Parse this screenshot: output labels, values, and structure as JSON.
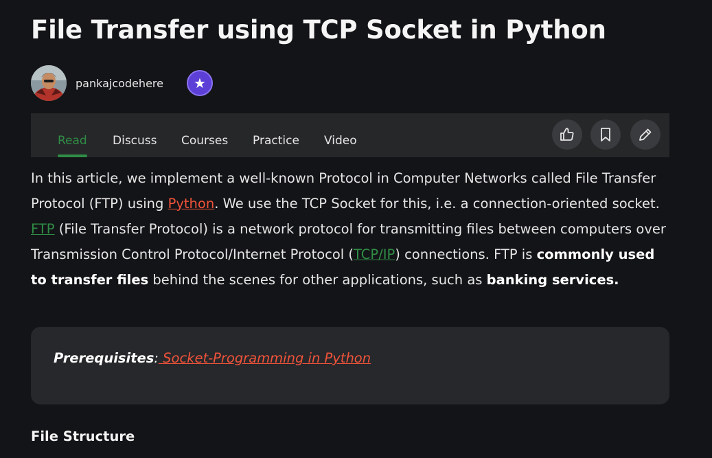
{
  "article": {
    "title": "File Transfer using TCP Socket in Python",
    "author": "pankajcodehere",
    "body": {
      "p1_a": "In this article, we implement a well-known Protocol in Computer Networks called File Transfer Protocol (FTP) using ",
      "link_python": "Python",
      "p1_b": ". We use the TCP Socket for this, i.e. a connection-oriented socket. ",
      "link_ftp": "FTP",
      "p1_c": " (File Transfer Protocol) is a network protocol for transmitting files between computers over Transmission Control Protocol/Internet Protocol (",
      "link_tcpip": "TCP/IP",
      "p1_d": ") connections. FTP is ",
      "bold_1": "commonly used to transfer files",
      "p1_e": " behind the scenes for other applications, such as ",
      "bold_2": "banking services."
    },
    "prerequisites": {
      "label": "Prerequisites",
      "colon": ":",
      "link": " Socket-Programming in Python"
    },
    "section_heading": "File Structure"
  },
  "tabs": {
    "read": "Read",
    "discuss": "Discuss",
    "courses": "Courses",
    "practice": "Practice",
    "video": "Video"
  },
  "icons": {
    "badge": "star-badge-icon",
    "like": "thumbs-up-icon",
    "bookmark": "bookmark-icon",
    "edit": "pencil-icon"
  },
  "colors": {
    "background": "#131417",
    "panel": "#262729",
    "accent_green": "#2f8d46",
    "link_red": "#f0533a",
    "badge_purple": "#5b3fd6"
  }
}
